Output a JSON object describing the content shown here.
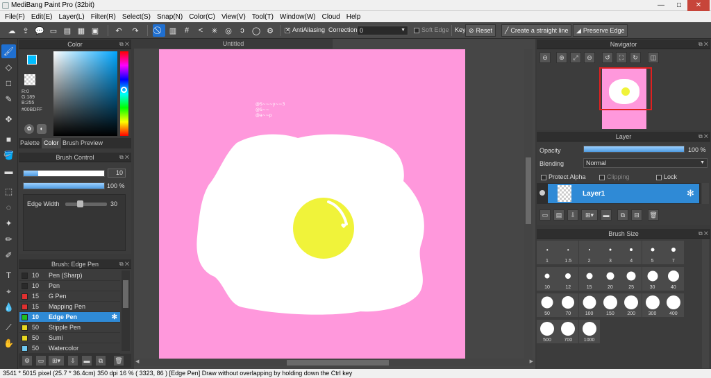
{
  "window": {
    "title": "MediBang Paint Pro (32bit)",
    "controls": [
      "—",
      "□",
      "✕"
    ]
  },
  "menu": [
    "File(F)",
    "Edit(E)",
    "Layer(L)",
    "Filter(R)",
    "Select(S)",
    "Snap(N)",
    "Color(C)",
    "View(V)",
    "Tool(T)",
    "Window(W)",
    "Cloud",
    "Help"
  ],
  "toolbar": {
    "antialiasing_label": "AntiAliasing",
    "antialiasing_checked": true,
    "correction_label": "Correction",
    "correction_value": "0",
    "soft_edge_label": "Soft Edge",
    "soft_edge_checked": false,
    "key_label": "Key",
    "reset_label": "Reset",
    "straight_line_label": "Create a straight line",
    "preserve_edge_label": "Preserve Edge"
  },
  "color_panel": {
    "title": "Color",
    "r": "R:0",
    "g": "G:189",
    "b": "B:255",
    "hex": "#00BDFF",
    "tabs": [
      "Palette",
      "Color",
      "Brush Preview"
    ],
    "active_tab": "Color",
    "primary_color": "#00BDFF"
  },
  "brush_control": {
    "title": "Brush Control",
    "size_value": "10",
    "opacity_value": "100 %",
    "opacity": 1.0,
    "edge_width_label": "Edge Width",
    "edge_width_value": "30"
  },
  "brush_list": {
    "title": "Brush: Edge Pen",
    "items": [
      {
        "size": "10",
        "name": "Pen (Sharp)",
        "color": "#2a2a2a"
      },
      {
        "size": "10",
        "name": "Pen",
        "color": "#2a2a2a"
      },
      {
        "size": "15",
        "name": "G Pen",
        "color": "#e03030"
      },
      {
        "size": "15",
        "name": "Mapping Pen",
        "color": "#e03030"
      },
      {
        "size": "10",
        "name": "Edge Pen",
        "color": "#20c020",
        "selected": true
      },
      {
        "size": "50",
        "name": "Stipple Pen",
        "color": "#e8d820"
      },
      {
        "size": "50",
        "name": "Sumi",
        "color": "#e8d820"
      },
      {
        "size": "50",
        "name": "Watercolor",
        "color": "#6ec8f0"
      }
    ]
  },
  "document": {
    "tab_title": "Untitled",
    "canvas_color": "#FF98DC",
    "signature_lines": [
      "@S~~~y~~3",
      "@S~~",
      "@a~~p"
    ]
  },
  "navigator": {
    "title": "Navigator"
  },
  "layer_panel": {
    "title": "Layer",
    "opacity_label": "Opacity",
    "opacity_value": "100 %",
    "opacity": 1.0,
    "blending_label": "Blending",
    "blending_value": "Normal",
    "protect_alpha_label": "Protect Alpha",
    "clipping_label": "Clipping",
    "lock_label": "Lock",
    "layer_name": "Layer1"
  },
  "brush_size_panel": {
    "title": "Brush Size",
    "sizes": [
      "1",
      "1.5",
      "2",
      "3",
      "4",
      "5",
      "7",
      "10",
      "12",
      "15",
      "20",
      "25",
      "30",
      "40",
      "50",
      "70",
      "100",
      "150",
      "200",
      "300",
      "400",
      "500",
      "700",
      "1000"
    ]
  },
  "status": "3541 * 5015 pixel   (25.7 * 36.4cm)   350 dpi   16 %   ( 3323, 86 )   [Edge Pen] Draw without overlapping by holding down the Ctrl key"
}
